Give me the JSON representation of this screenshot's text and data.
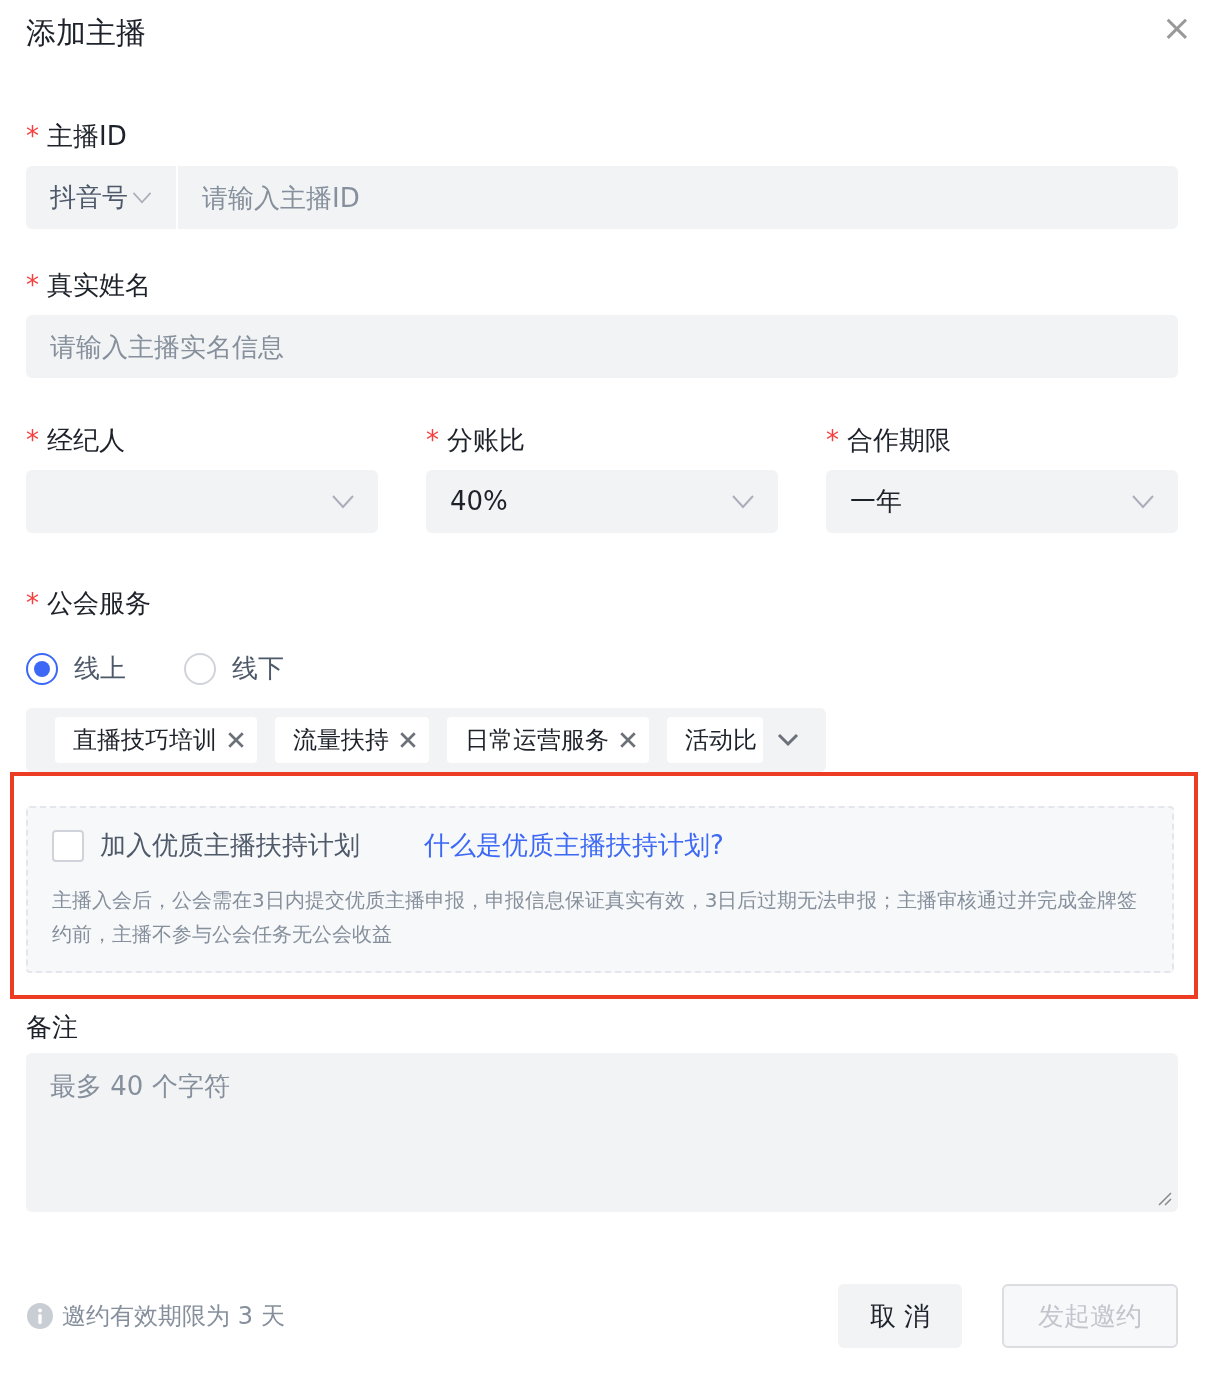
{
  "dialog": {
    "title": "添加主播",
    "close": "×"
  },
  "anchor_id": {
    "label": "主播ID",
    "required_mark": "*",
    "prefix": "抖音号",
    "placeholder": "请输入主播ID"
  },
  "real_name": {
    "label": "真实姓名",
    "required_mark": "*",
    "placeholder": "请输入主播实名信息"
  },
  "selects": [
    {
      "label": "经纪人",
      "required_mark": "*"
    },
    {
      "label": "分账比",
      "required_mark": "*",
      "value": "40%"
    },
    {
      "label": "合作期限",
      "required_mark": "*",
      "value": "一年"
    }
  ],
  "guild_service": {
    "label": "公会服务",
    "required_mark": "*",
    "options": [
      {
        "label": "线上",
        "selected": true
      },
      {
        "label": "线下",
        "selected": false
      }
    ],
    "tags": [
      "直播技巧培训",
      "流量扶持",
      "日常运营服务",
      "活动比"
    ]
  },
  "plan": {
    "highlighted": true,
    "checkbox_label": "加入优质主播扶持计划",
    "checked": false,
    "link": "什么是优质主播扶持计划?",
    "note": "主播入会后，公会需在3日内提交优质主播申报，申报信息保证真实有效，3日后过期无法申报；主播审核通过并完成金牌签约前，主播不参与公会任务无公会收益"
  },
  "remark": {
    "label": "备注",
    "placeholder": "最多 40 个字符"
  },
  "footer": {
    "hint": "邀约有效期限为 3 天",
    "cancel": {
      "label": "取 消"
    },
    "submit": {
      "label": "发起邀约",
      "disabled": true
    }
  }
}
